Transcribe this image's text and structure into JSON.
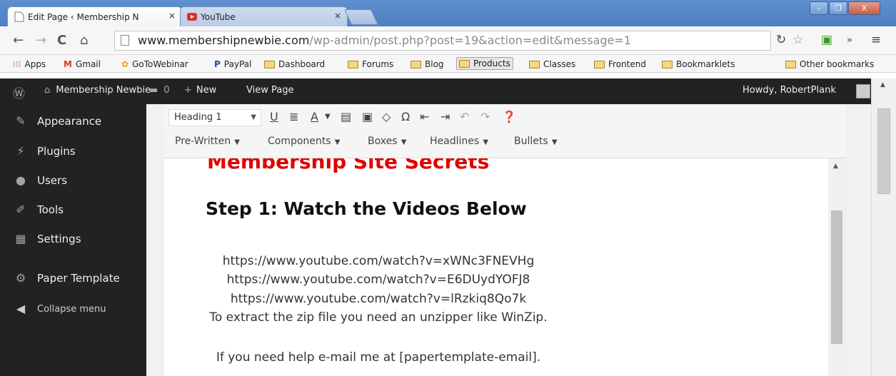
{
  "browser": {
    "tabs": [
      {
        "title": "Edit Page ‹ Membership N",
        "close": "×"
      },
      {
        "title": "YouTube",
        "close": "×"
      }
    ],
    "window_buttons": {
      "minimize": "–",
      "restore": "❐",
      "close": "X"
    },
    "url_host": "www.membershipnewbie.com",
    "url_path": "/wp-admin/post.php?post=19&action=edit&message=1",
    "bookmarks": [
      "Apps",
      "Gmail",
      "GoToWebinar",
      "PayPal",
      "Dashboard",
      "Forums",
      "Blog",
      "Products",
      "Classes",
      "Frontend",
      "Bookmarklets"
    ],
    "other_bookmarks": "Other bookmarks"
  },
  "adminbar": {
    "site": "Membership Newbie",
    "comments": "0",
    "new": "New",
    "view": "View Page",
    "howdy": "Howdy, RobertPlank"
  },
  "sidebar": {
    "items": [
      "Appearance",
      "Plugins",
      "Users",
      "Tools",
      "Settings",
      "Paper Template"
    ],
    "collapse": "Collapse menu"
  },
  "editor": {
    "format_select": "Heading 1",
    "row2": [
      "Pre-Written",
      "Components",
      "Boxes",
      "Headlines",
      "Bullets"
    ],
    "cut_heading": "Membership Site Secrets",
    "heading": "Step 1: Watch the Videos Below",
    "lines": [
      "https://www.youtube.com/watch?v=xWNc3FNEVHg",
      "https://www.youtube.com/watch?v=E6DUydYOFJ8",
      "https://www.youtube.com/watch?v=lRzkiq8Qo7k",
      "To extract the zip file you need an unzipper like WinZip.",
      "",
      "If you need help e-mail me at [papertemplate-email]."
    ]
  }
}
